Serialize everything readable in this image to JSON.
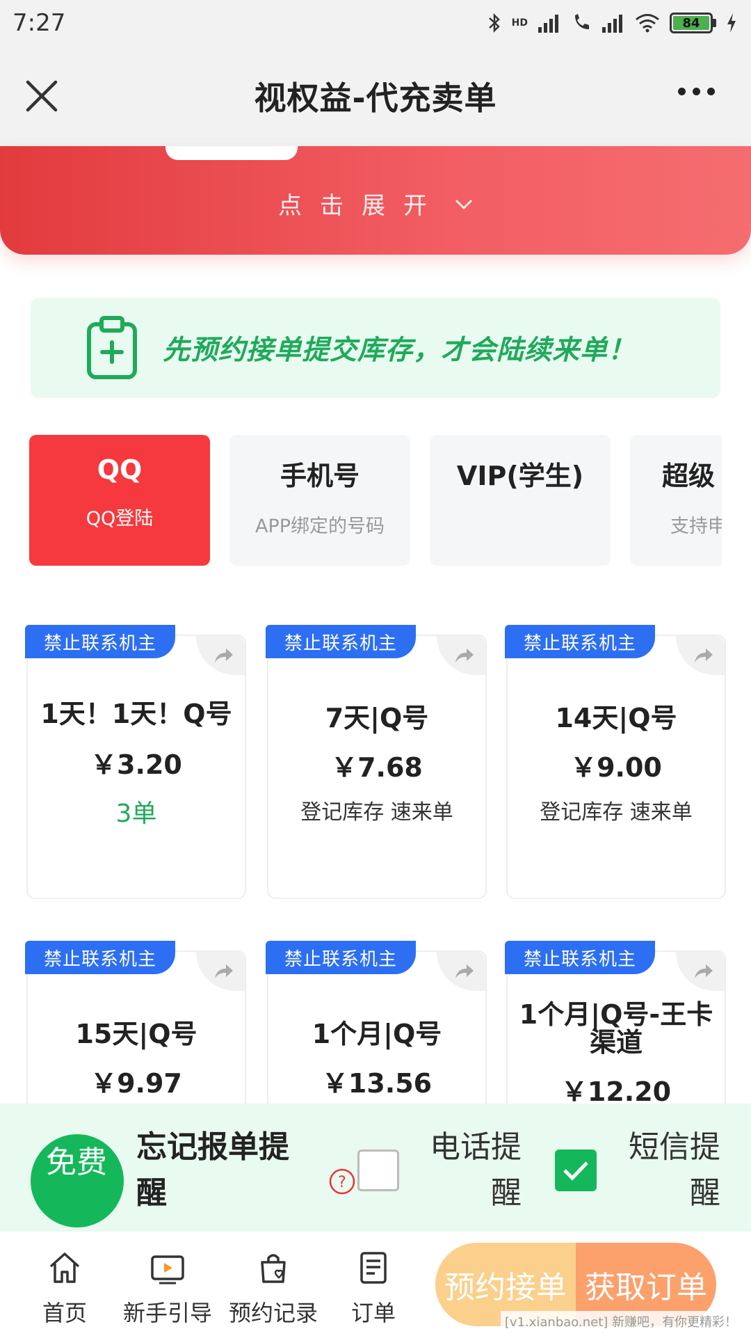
{
  "status_bar": {
    "time": "7:27",
    "signal_labels": "HD",
    "battery": "84"
  },
  "title_bar": {
    "title": "视权益-代充卖单"
  },
  "banner": {
    "expand_label": "点击展开"
  },
  "notice": {
    "text": "先预约接单提交库存，才会陆续来单！"
  },
  "categories": [
    {
      "title": "QQ",
      "subtitle": "QQ登陆",
      "active": true
    },
    {
      "title": "手机号",
      "subtitle": "APP绑定的号码",
      "active": false
    },
    {
      "title": "VIP(学生)",
      "subtitle": "",
      "active": false
    },
    {
      "title": "超级",
      "subtitle": "支持申",
      "active": false
    }
  ],
  "products": [
    {
      "badge": "禁止联系机主",
      "name": "1天！1天！Q号",
      "price": "￥3.20",
      "tag": "3单"
    },
    {
      "badge": "禁止联系机主",
      "name": "7天|Q号",
      "price": "￥7.68",
      "tag": "登记库存 速来单"
    },
    {
      "badge": "禁止联系机主",
      "name": "14天|Q号",
      "price": "￥9.00",
      "tag": "登记库存 速来单"
    },
    {
      "badge": "禁止联系机主",
      "name": "15天|Q号",
      "price": "￥9.97",
      "tag": ""
    },
    {
      "badge": "禁止联系机主",
      "name": "1个月|Q号",
      "price": "￥13.56",
      "tag": ""
    },
    {
      "badge": "禁止联系机主",
      "name": "1个月|Q号-王卡渠道",
      "price": "￥12.20",
      "tag": ""
    }
  ],
  "reminder": {
    "free_badge": "免费",
    "title": "忘记报单提醒",
    "phone_label": "电话提醒",
    "phone_checked": false,
    "sms_label": "短信提醒",
    "sms_checked": true
  },
  "bottom_nav": {
    "items": [
      {
        "label": "首页",
        "icon": "home-icon"
      },
      {
        "label": "新手引导",
        "icon": "play-video-icon"
      },
      {
        "label": "预约记录",
        "icon": "bag-heart-icon"
      },
      {
        "label": "订单",
        "icon": "document-icon"
      }
    ],
    "reserve_label": "预约接单",
    "get_order_label": "获取订单"
  },
  "watermark": "[v1.xianbao.net] 新赚吧，有你更精彩！",
  "colors": {
    "accent_red": "#f5393e",
    "accent_green": "#1faa5b",
    "badge_blue": "#2d6ff2"
  }
}
